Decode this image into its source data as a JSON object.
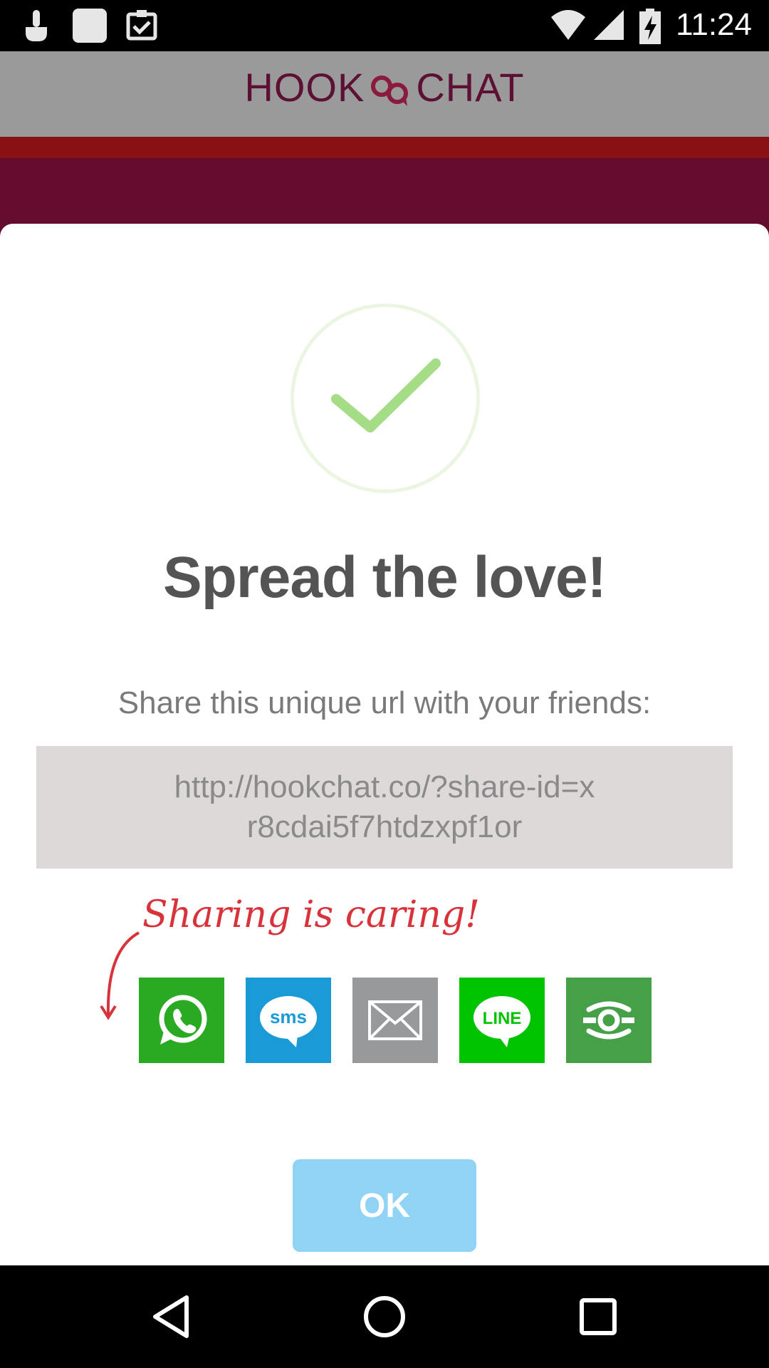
{
  "status_bar": {
    "time": "11:24",
    "icons": [
      "tap-notification-icon",
      "blank-notification-icon",
      "clipboard-check-icon",
      "wifi-icon",
      "signal-icon",
      "battery-charging-icon"
    ]
  },
  "header": {
    "logo_left": "HOOK",
    "logo_right": "CHAT"
  },
  "dialog": {
    "title": "Spread the love!",
    "subtitle": "Share this unique url with your friends:",
    "share_url": "http://hookchat.co/?share-id=xr8cdai5f7htdzxpf1or",
    "handwriting": "Sharing is caring!",
    "share_buttons": [
      {
        "name": "whatsapp",
        "icon": "whatsapp-icon",
        "color": "#2aaa22"
      },
      {
        "name": "sms",
        "icon": "sms-icon",
        "label": "sms",
        "color": "#1a9ad6"
      },
      {
        "name": "email",
        "icon": "envelope-icon",
        "color": "#97999b"
      },
      {
        "name": "line",
        "icon": "line-icon",
        "label": "LINE",
        "color": "#00c300"
      },
      {
        "name": "other",
        "icon": "share-other-icon",
        "color": "#45a048"
      }
    ],
    "ok_label": "OK"
  },
  "colors": {
    "header_bg": "#9a9a9a",
    "red_strip": "#8a1113",
    "maroon": "#650b2e",
    "check_green": "#a5dc86",
    "ok_button": "#91d3f4"
  },
  "nav": {
    "icons": [
      "back-icon",
      "home-icon",
      "recent-apps-icon"
    ]
  }
}
